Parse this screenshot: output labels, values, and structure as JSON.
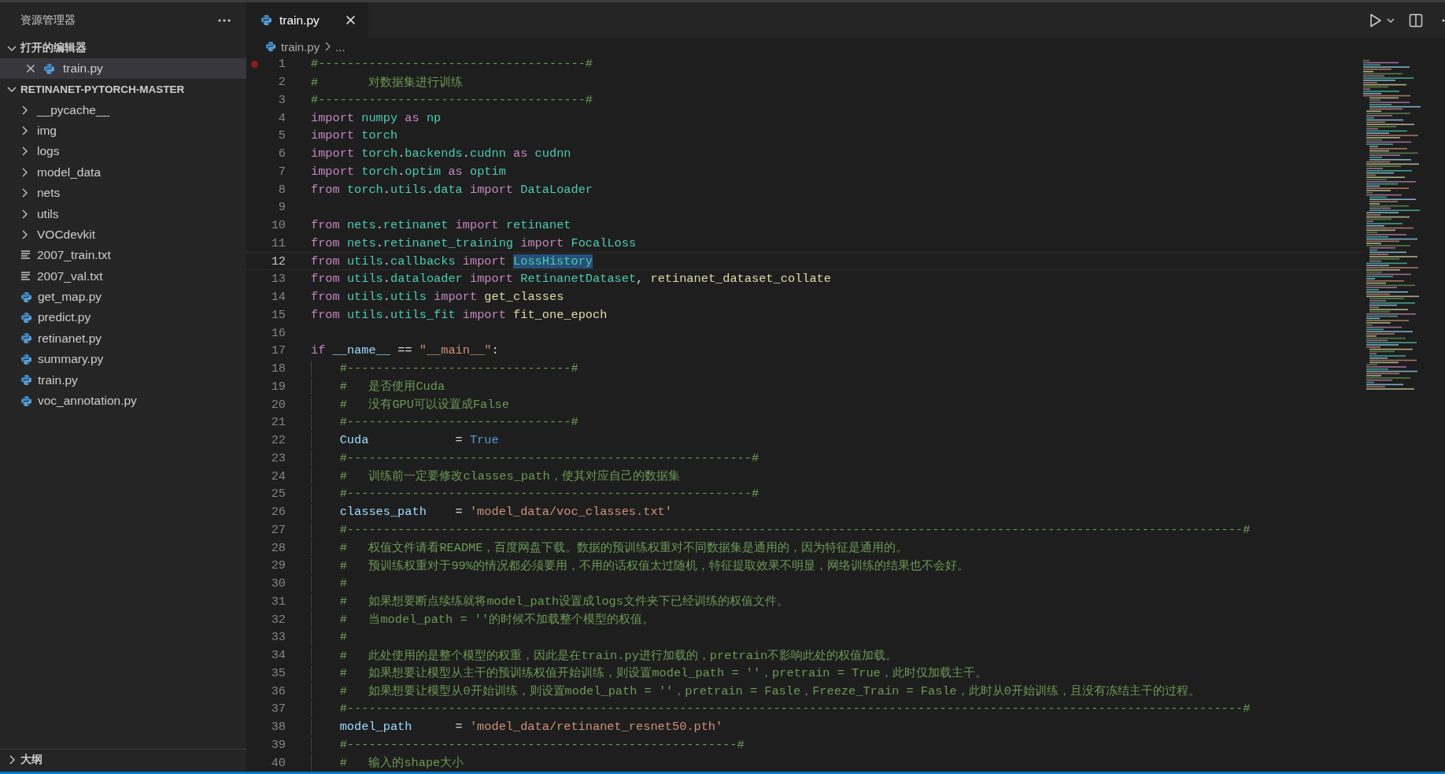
{
  "sidebar": {
    "title": "资源管理器",
    "sections": [
      {
        "title": "打开的编辑器",
        "expanded": true,
        "items": [
          {
            "name": "train.py",
            "kind": "python",
            "selected": true
          }
        ]
      },
      {
        "title": "RETINANET-PYTORCH-MASTER",
        "expanded": true,
        "items": [
          {
            "name": "__pycache__",
            "kind": "folder",
            "expanded": false,
            "selected": false
          },
          {
            "name": "img",
            "kind": "folder",
            "expanded": false,
            "selected": false
          },
          {
            "name": "logs",
            "kind": "folder",
            "expanded": false,
            "selected": false
          },
          {
            "name": "model_data",
            "kind": "folder",
            "expanded": false,
            "selected": false
          },
          {
            "name": "nets",
            "kind": "folder",
            "expanded": false,
            "selected": false
          },
          {
            "name": "utils",
            "kind": "folder",
            "expanded": false,
            "selected": false
          },
          {
            "name": "VOCdevkit",
            "kind": "folder",
            "expanded": false,
            "selected": false
          },
          {
            "name": "2007_train.txt",
            "kind": "text",
            "selected": false
          },
          {
            "name": "2007_val.txt",
            "kind": "text",
            "selected": false
          },
          {
            "name": "get_map.py",
            "kind": "python",
            "selected": false
          },
          {
            "name": "predict.py",
            "kind": "python",
            "selected": false
          },
          {
            "name": "retinanet.py",
            "kind": "python",
            "selected": false
          },
          {
            "name": "summary.py",
            "kind": "python",
            "selected": false
          },
          {
            "name": "train.py",
            "kind": "python",
            "selected": false
          },
          {
            "name": "voc_annotation.py",
            "kind": "python",
            "selected": false
          }
        ]
      }
    ],
    "outline": {
      "title": "大纲",
      "expanded": false
    }
  },
  "tabs": [
    {
      "label": "train.py",
      "selected": true
    }
  ],
  "breadcrumb": [
    "train.py",
    "..."
  ],
  "editor": {
    "lines": [
      {
        "number": "1",
        "breakpoint": true,
        "current": false,
        "tokens": [
          {
            "text": "#-------------------------------------#",
            "kind": "comment"
          }
        ]
      },
      {
        "number": "2",
        "breakpoint": false,
        "current": false,
        "tokens": [
          {
            "text": "#       对数据集进行训练",
            "kind": "comment"
          }
        ]
      },
      {
        "number": "3",
        "breakpoint": false,
        "current": false,
        "tokens": [
          {
            "text": "#-------------------------------------#",
            "kind": "comment"
          }
        ]
      },
      {
        "number": "4",
        "breakpoint": false,
        "current": false,
        "tokens": [
          {
            "text": "import",
            "kind": "keyword"
          },
          {
            "text": " numpy",
            "kind": "module"
          },
          {
            "text": " as",
            "kind": "keyword"
          },
          {
            "text": " np",
            "kind": "module"
          }
        ]
      },
      {
        "number": "5",
        "breakpoint": false,
        "current": false,
        "tokens": [
          {
            "text": "import",
            "kind": "keyword"
          },
          {
            "text": " torch",
            "kind": "module"
          }
        ]
      },
      {
        "number": "6",
        "breakpoint": false,
        "current": false,
        "tokens": [
          {
            "text": "import",
            "kind": "keyword"
          },
          {
            "text": " torch",
            "kind": "module"
          },
          {
            "text": ".",
            "kind": "plain"
          },
          {
            "text": "backends",
            "kind": "module"
          },
          {
            "text": ".",
            "kind": "plain"
          },
          {
            "text": "cudnn",
            "kind": "module"
          },
          {
            "text": " as",
            "kind": "keyword"
          },
          {
            "text": " cudnn",
            "kind": "module"
          }
        ]
      },
      {
        "number": "7",
        "breakpoint": false,
        "current": false,
        "tokens": [
          {
            "text": "import",
            "kind": "keyword"
          },
          {
            "text": " torch",
            "kind": "module"
          },
          {
            "text": ".",
            "kind": "plain"
          },
          {
            "text": "optim",
            "kind": "module"
          },
          {
            "text": " as",
            "kind": "keyword"
          },
          {
            "text": " optim",
            "kind": "module"
          }
        ]
      },
      {
        "number": "8",
        "breakpoint": false,
        "current": false,
        "tokens": [
          {
            "text": "from",
            "kind": "keyword"
          },
          {
            "text": " torch",
            "kind": "module"
          },
          {
            "text": ".",
            "kind": "plain"
          },
          {
            "text": "utils",
            "kind": "module"
          },
          {
            "text": ".",
            "kind": "plain"
          },
          {
            "text": "data",
            "kind": "module"
          },
          {
            "text": " import",
            "kind": "keyword"
          },
          {
            "text": " DataLoader",
            "kind": "module"
          }
        ]
      },
      {
        "number": "9",
        "breakpoint": false,
        "current": false
      },
      {
        "number": "10",
        "breakpoint": false,
        "current": false,
        "tokens": [
          {
            "text": "from",
            "kind": "keyword"
          },
          {
            "text": " nets",
            "kind": "module"
          },
          {
            "text": ".",
            "kind": "plain"
          },
          {
            "text": "retinanet",
            "kind": "module"
          },
          {
            "text": " import",
            "kind": "keyword"
          },
          {
            "text": " retinanet",
            "kind": "module"
          }
        ]
      },
      {
        "number": "11",
        "breakpoint": false,
        "current": false,
        "tokens": [
          {
            "text": "from",
            "kind": "keyword"
          },
          {
            "text": " nets",
            "kind": "module"
          },
          {
            "text": ".",
            "kind": "plain"
          },
          {
            "text": "retinanet_training",
            "kind": "module"
          },
          {
            "text": " import",
            "kind": "keyword"
          },
          {
            "text": " FocalLoss",
            "kind": "module"
          }
        ]
      },
      {
        "number": "12",
        "breakpoint": false,
        "current": true,
        "tokens": [
          {
            "text": "from",
            "kind": "keyword"
          },
          {
            "text": " utils",
            "kind": "module"
          },
          {
            "text": ".",
            "kind": "plain"
          },
          {
            "text": "callbacks",
            "kind": "module"
          },
          {
            "text": " import ",
            "kind": "keyword"
          },
          {
            "text": "LossHistory",
            "kind": "module",
            "highlighted": true
          }
        ]
      },
      {
        "number": "13",
        "breakpoint": false,
        "current": false,
        "tokens": [
          {
            "text": "from",
            "kind": "keyword"
          },
          {
            "text": " utils",
            "kind": "module"
          },
          {
            "text": ".",
            "kind": "plain"
          },
          {
            "text": "dataloader",
            "kind": "module"
          },
          {
            "text": " import",
            "kind": "keyword"
          },
          {
            "text": " RetinanetDataset",
            "kind": "module"
          },
          {
            "text": ", ",
            "kind": "plain"
          },
          {
            "text": "retinanet_dataset_collate",
            "kind": "function"
          }
        ]
      },
      {
        "number": "14",
        "breakpoint": false,
        "current": false,
        "tokens": [
          {
            "text": "from",
            "kind": "keyword"
          },
          {
            "text": " utils",
            "kind": "module"
          },
          {
            "text": ".",
            "kind": "plain"
          },
          {
            "text": "utils",
            "kind": "module"
          },
          {
            "text": " import",
            "kind": "keyword"
          },
          {
            "text": " get_classes",
            "kind": "function"
          }
        ]
      },
      {
        "number": "15",
        "breakpoint": false,
        "current": false,
        "tokens": [
          {
            "text": "from",
            "kind": "keyword"
          },
          {
            "text": " utils",
            "kind": "module"
          },
          {
            "text": ".",
            "kind": "plain"
          },
          {
            "text": "utils_fit",
            "kind": "module"
          },
          {
            "text": " import",
            "kind": "keyword"
          },
          {
            "text": " fit_one_epoch",
            "kind": "function"
          }
        ]
      },
      {
        "number": "16",
        "breakpoint": false,
        "current": false
      },
      {
        "number": "17",
        "breakpoint": false,
        "current": false,
        "tokens": [
          {
            "text": "if ",
            "kind": "keyword"
          },
          {
            "text": "__name__",
            "kind": "variable"
          },
          {
            "text": " == ",
            "kind": "plain"
          },
          {
            "text": "\"__main__\"",
            "kind": "string"
          },
          {
            "text": ":",
            "kind": "plain"
          }
        ],
        "children": [
          {
            "number": "18",
            "breakpoint": false,
            "current": false,
            "tokens": [
              {
                "text": "#-------------------------------#",
                "kind": "comment"
              }
            ]
          },
          {
            "number": "19",
            "breakpoint": false,
            "current": false,
            "tokens": [
              {
                "text": "#   是否使用Cuda",
                "kind": "comment"
              }
            ]
          },
          {
            "number": "20",
            "breakpoint": false,
            "current": false,
            "tokens": [
              {
                "text": "#   没有GPU可以设置成False",
                "kind": "comment"
              }
            ]
          },
          {
            "number": "21",
            "breakpoint": false,
            "current": false,
            "tokens": [
              {
                "text": "#-------------------------------#",
                "kind": "comment"
              }
            ]
          },
          {
            "number": "22",
            "breakpoint": false,
            "current": false,
            "tokens": [
              {
                "text": "Cuda",
                "kind": "variable"
              },
              {
                "text": "            = ",
                "kind": "plain"
              },
              {
                "text": "True",
                "kind": "constant"
              }
            ]
          },
          {
            "number": "23",
            "breakpoint": false,
            "current": false,
            "tokens": [
              {
                "text": "#--------------------------------------------------------#",
                "kind": "comment"
              }
            ]
          },
          {
            "number": "24",
            "breakpoint": false,
            "current": false,
            "tokens": [
              {
                "text": "#   训练前一定要修改classes_path，使其对应自己的数据集",
                "kind": "comment"
              }
            ]
          },
          {
            "number": "25",
            "breakpoint": false,
            "current": false,
            "tokens": [
              {
                "text": "#--------------------------------------------------------#",
                "kind": "comment"
              }
            ]
          },
          {
            "number": "26",
            "breakpoint": false,
            "current": false,
            "tokens": [
              {
                "text": "classes_path",
                "kind": "variable"
              },
              {
                "text": "    = ",
                "kind": "plain"
              },
              {
                "text": "'model_data/voc_classes.txt'",
                "kind": "string"
              }
            ]
          },
          {
            "number": "27",
            "breakpoint": false,
            "current": false,
            "tokens": [
              {
                "text": "#----------------------------------------------------------------------------------------------------------------------------#",
                "kind": "comment"
              }
            ]
          },
          {
            "number": "28",
            "breakpoint": false,
            "current": false,
            "tokens": [
              {
                "text": "#   权值文件请看README，百度网盘下载。数据的预训练权重对不同数据集是通用的，因为特征是通用的。",
                "kind": "comment"
              }
            ]
          },
          {
            "number": "29",
            "breakpoint": false,
            "current": false,
            "tokens": [
              {
                "text": "#   预训练权重对于99%的情况都必须要用，不用的话权值太过随机，特征提取效果不明显，网络训练的结果也不会好。",
                "kind": "comment"
              }
            ]
          },
          {
            "number": "30",
            "breakpoint": false,
            "current": false,
            "tokens": [
              {
                "text": "#",
                "kind": "comment"
              }
            ]
          },
          {
            "number": "31",
            "breakpoint": false,
            "current": false,
            "tokens": [
              {
                "text": "#   如果想要断点续练就将model_path设置成logs文件夹下已经训练的权值文件。",
                "kind": "comment"
              }
            ]
          },
          {
            "number": "32",
            "breakpoint": false,
            "current": false,
            "tokens": [
              {
                "text": "#   当model_path = ''的时候不加载整个模型的权值。",
                "kind": "comment"
              }
            ]
          },
          {
            "number": "33",
            "breakpoint": false,
            "current": false,
            "tokens": [
              {
                "text": "#",
                "kind": "comment"
              }
            ]
          },
          {
            "number": "34",
            "breakpoint": false,
            "current": false,
            "tokens": [
              {
                "text": "#   此处使用的是整个模型的权重，因此是在train.py进行加载的，pretrain不影响此处的权值加载。",
                "kind": "comment"
              }
            ]
          },
          {
            "number": "35",
            "breakpoint": false,
            "current": false,
            "tokens": [
              {
                "text": "#   如果想要让模型从主干的预训练权值开始训练，则设置model_path = ''，pretrain = True，此时仅加载主干。",
                "kind": "comment"
              }
            ]
          },
          {
            "number": "36",
            "breakpoint": false,
            "current": false,
            "tokens": [
              {
                "text": "#   如果想要让模型从0开始训练，则设置model_path = ''，pretrain = Fasle，Freeze_Train = Fasle，此时从0开始训练，且没有冻结主干的过程。",
                "kind": "comment"
              }
            ]
          },
          {
            "number": "37",
            "breakpoint": false,
            "current": false,
            "tokens": [
              {
                "text": "#----------------------------------------------------------------------------------------------------------------------------#",
                "kind": "comment"
              }
            ]
          },
          {
            "number": "38",
            "breakpoint": false,
            "current": false,
            "tokens": [
              {
                "text": "model_path",
                "kind": "variable"
              },
              {
                "text": "      = ",
                "kind": "plain"
              },
              {
                "text": "'model_data/retinanet_resnet50.pth'",
                "kind": "string"
              }
            ]
          },
          {
            "number": "39",
            "breakpoint": false,
            "current": false,
            "tokens": [
              {
                "text": "#------------------------------------------------------#",
                "kind": "comment"
              }
            ]
          },
          {
            "number": "40",
            "breakpoint": false,
            "current": false,
            "tokens": [
              {
                "text": "#   输入的shape大小",
                "kind": "comment"
              }
            ]
          }
        ]
      }
    ]
  }
}
